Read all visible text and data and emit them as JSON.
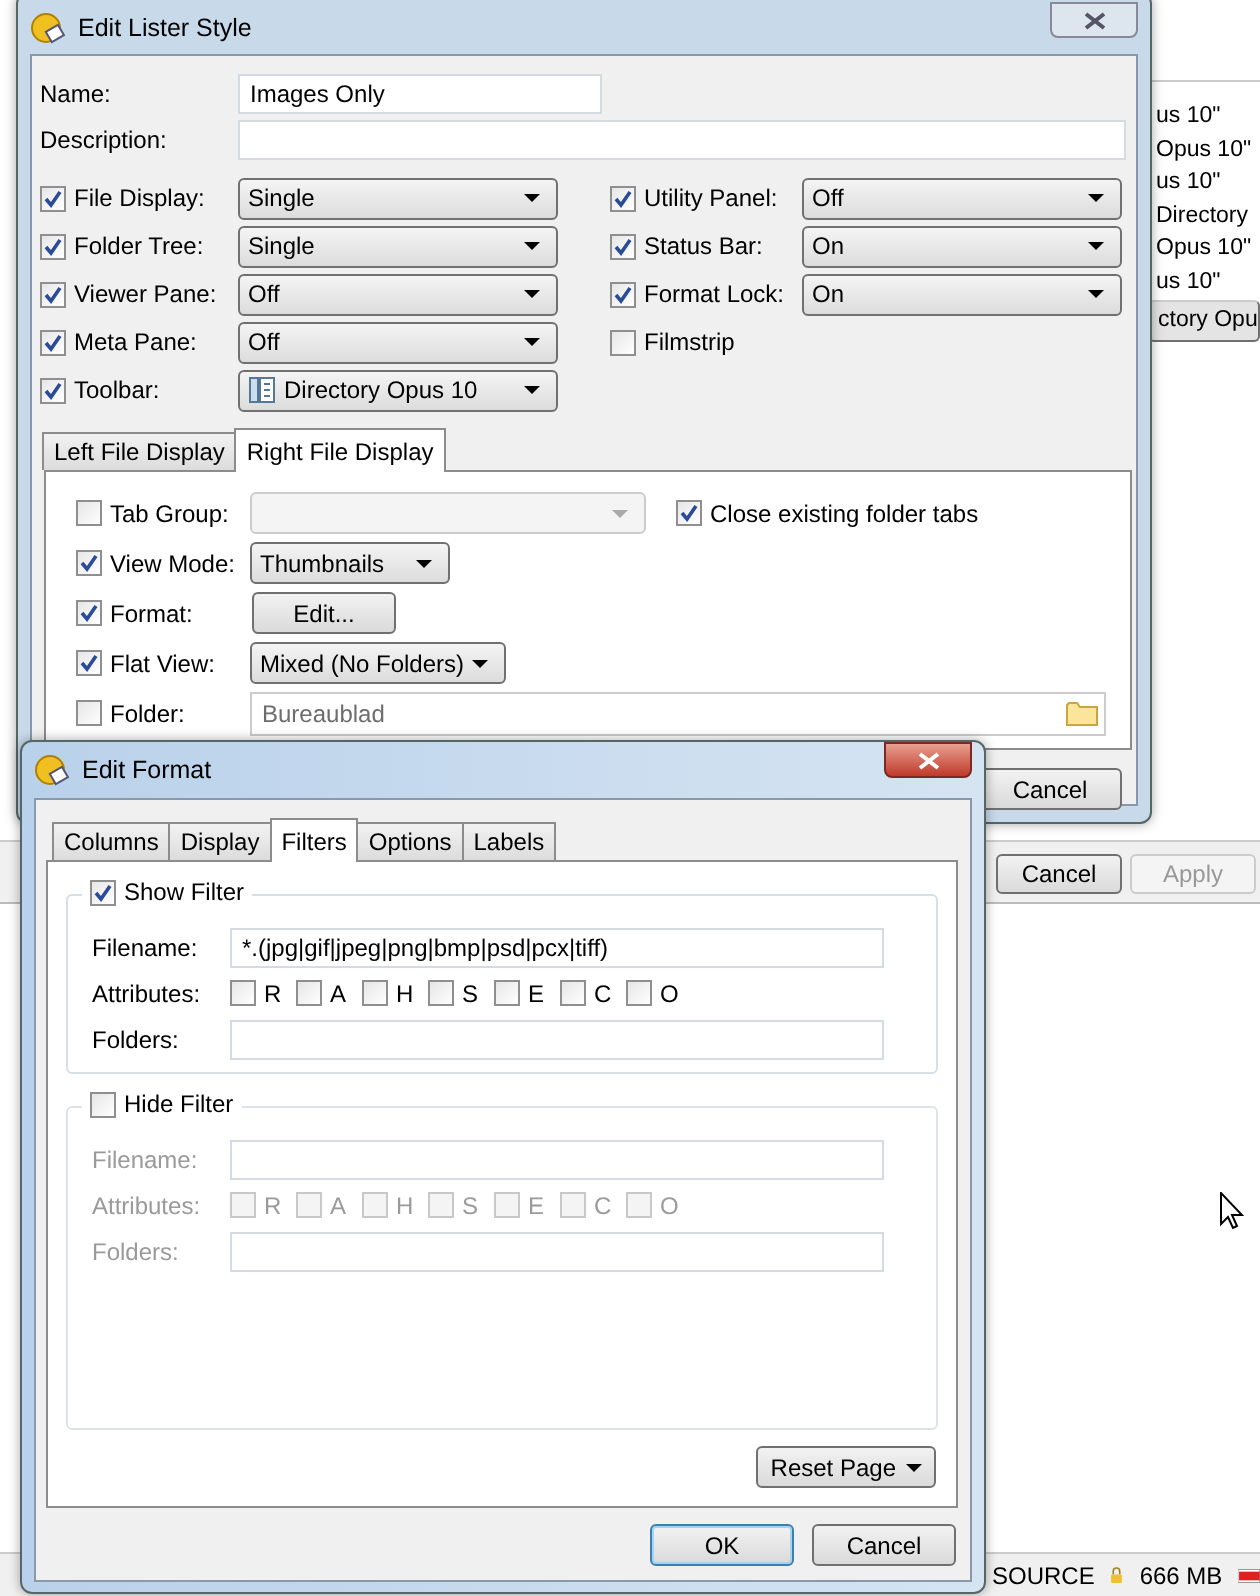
{
  "background_window": {
    "list_items": [
      {
        "text": "us 10\"",
        "selected": false
      },
      {
        "text": "Opus 10\"",
        "selected": false
      },
      {
        "text": "us 10\"",
        "selected": false
      },
      {
        "text": "Directory",
        "selected": false
      },
      {
        "text": "Opus 10\"",
        "selected": false
      },
      {
        "text": "us 10\"",
        "selected": false
      },
      {
        "text": "ctory Opu",
        "selected": true
      }
    ],
    "buttons": [
      {
        "label": "Cancel",
        "disabled": false
      },
      {
        "label": "Apply",
        "disabled": true
      }
    ],
    "status_bar": {
      "source": "SOURCE",
      "memory": "666 MB"
    }
  },
  "lister_dialog": {
    "title": "Edit Lister Style",
    "name_label": "Name:",
    "name_value": "Images Only",
    "description_label": "Description:",
    "left_options": [
      {
        "label": "File Display:",
        "checked": true,
        "kind": "select",
        "value": "Single"
      },
      {
        "label": "Folder Tree:",
        "checked": true,
        "kind": "select",
        "value": "Single"
      },
      {
        "label": "Viewer Pane:",
        "checked": true,
        "kind": "select",
        "value": "Off"
      },
      {
        "label": "Meta Pane:",
        "checked": true,
        "kind": "select",
        "value": "Off"
      },
      {
        "label": "Toolbar:",
        "checked": true,
        "kind": "select_icon",
        "value": "Directory Opus 10"
      }
    ],
    "right_options": [
      {
        "label": "Utility Panel:",
        "checked": true,
        "kind": "select",
        "value": "Off"
      },
      {
        "label": "Status Bar:",
        "checked": true,
        "kind": "select",
        "value": "On"
      },
      {
        "label": "Format Lock:",
        "checked": true,
        "kind": "select",
        "value": "On"
      },
      {
        "label": "Filmstrip",
        "checked": false,
        "kind": "checkbox"
      }
    ],
    "tabs": [
      {
        "label": "Left File Display",
        "selected": false
      },
      {
        "label": "Right File Display",
        "selected": true
      }
    ],
    "tab_rows": [
      {
        "label": "Tab Group:",
        "checked": false,
        "kind": "select",
        "disabled": true,
        "side_option": {
          "label": "Close existing folder tabs",
          "checked": true
        }
      },
      {
        "label": "View Mode:",
        "checked": true,
        "kind": "select",
        "disabled": false,
        "value": "Thumbnails"
      },
      {
        "label": "Format:",
        "checked": true,
        "kind": "button",
        "disabled": false,
        "value": "Edit..."
      },
      {
        "label": "Flat View:",
        "checked": true,
        "kind": "select",
        "disabled": false,
        "value": "Mixed (No Folders)"
      },
      {
        "label": "Folder:",
        "checked": false,
        "kind": "folder",
        "disabled": true,
        "value": "Bureaublad"
      }
    ],
    "cancel_button": "Cancel"
  },
  "format_dialog": {
    "title": "Edit Format",
    "tabs": [
      {
        "label": "Columns",
        "selected": false
      },
      {
        "label": "Display",
        "selected": false
      },
      {
        "label": "Filters",
        "selected": true
      },
      {
        "label": "Options",
        "selected": false
      },
      {
        "label": "Labels",
        "selected": false
      }
    ],
    "groups": [
      {
        "title": "Show Filter",
        "checked": true,
        "disabled": false,
        "filename_label": "Filename:",
        "filename_value": "*.(jpg|gif|jpeg|png|bmp|psd|pcx|tiff)",
        "attributes_label": "Attributes:",
        "folders_label": "Folders:",
        "attributes": [
          {
            "letter": "R",
            "checked": false
          },
          {
            "letter": "A",
            "checked": false
          },
          {
            "letter": "H",
            "checked": false
          },
          {
            "letter": "S",
            "checked": false
          },
          {
            "letter": "E",
            "checked": false
          },
          {
            "letter": "C",
            "checked": false
          },
          {
            "letter": "O",
            "checked": false
          }
        ]
      },
      {
        "title": "Hide Filter",
        "checked": false,
        "disabled": true,
        "filename_label": "Filename:",
        "attributes_label": "Attributes:",
        "folders_label": "Folders:",
        "attributes": [
          {
            "letter": "R",
            "checked": false
          },
          {
            "letter": "A",
            "checked": false
          },
          {
            "letter": "H",
            "checked": false
          },
          {
            "letter": "S",
            "checked": false
          },
          {
            "letter": "E",
            "checked": false
          },
          {
            "letter": "C",
            "checked": false
          },
          {
            "letter": "O",
            "checked": false
          }
        ]
      }
    ],
    "reset_button": "Reset Page",
    "ok_button": "OK",
    "cancel_button": "Cancel"
  }
}
